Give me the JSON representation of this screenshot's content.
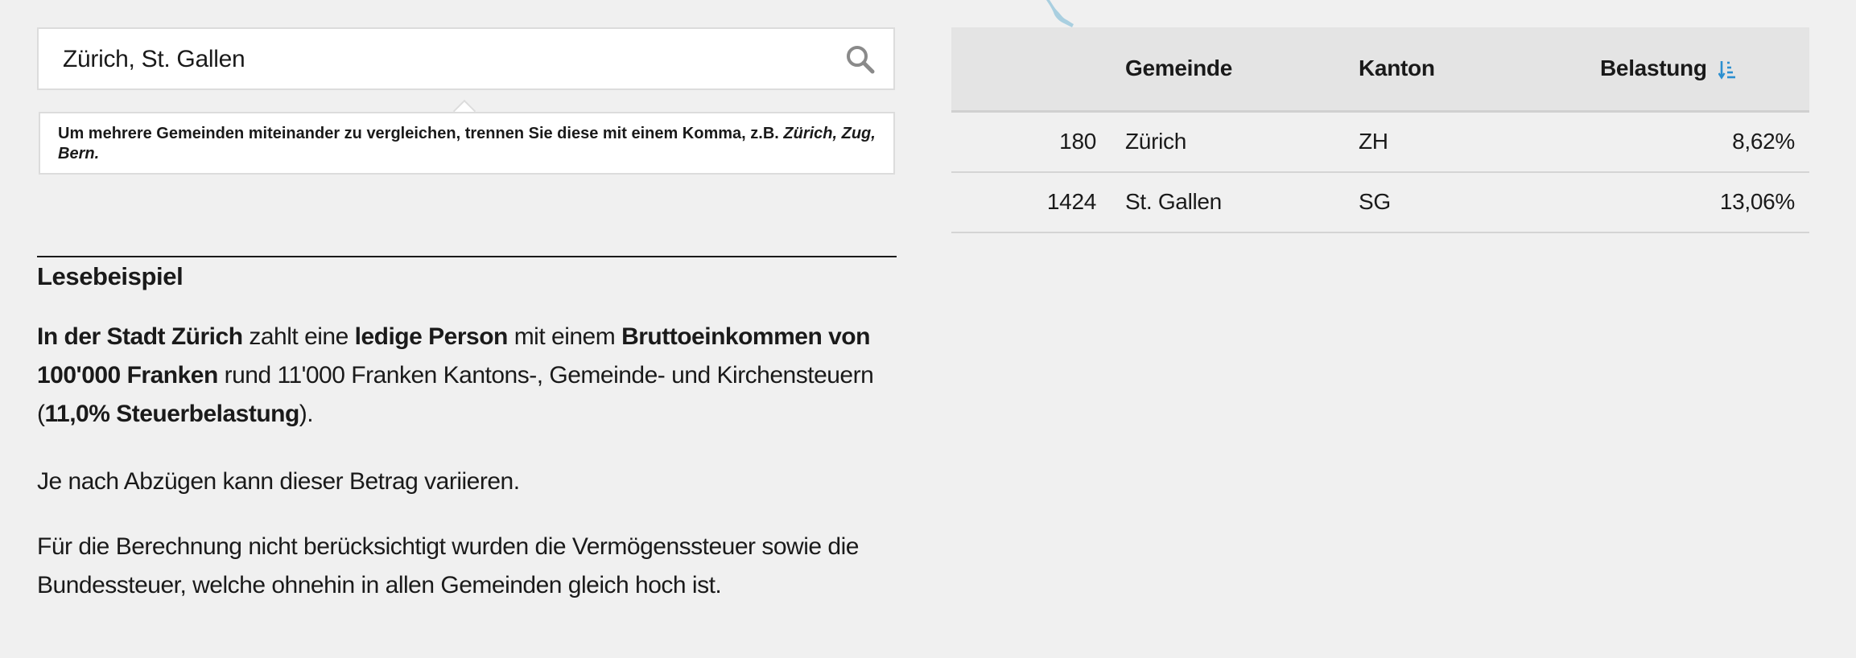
{
  "search": {
    "value": "Zürich, St. Gallen",
    "icon": "search-icon"
  },
  "hint": {
    "text": "Um mehrere Gemeinden miteinander zu vergleichen, trennen Sie diese mit einem Komma, z.B.",
    "examples": "Zürich, Zug, Bern."
  },
  "example": {
    "heading": "Lesebeispiel",
    "p1": {
      "b1": "In der Stadt Zürich",
      "t1": " zahlt eine ",
      "b2": "ledige Person",
      "t2": " mit einem ",
      "b3": "Bruttoeinkommen von 100'000 Franken",
      "t3": " rund 11'000 Franken Kantons-, Gemeinde- und Kirchensteuern (",
      "b4": "11,0% Steuerbelastung",
      "t4": ")."
    },
    "p2": "Je nach Abzügen kann dieser Betrag variieren.",
    "p3": "Für die Berechnung nicht berücksichtigt wurden die Vermögenssteuer sowie die Bundessteuer, welche ohnehin in allen Gemeinden gleich hoch ist."
  },
  "table": {
    "headers": {
      "rank": "",
      "gemeinde": "Gemeinde",
      "kanton": "Kanton",
      "belastung": "Belastung"
    },
    "sort_icon": "sort-descending-icon",
    "rows": [
      {
        "rank": "180",
        "gemeinde": "Zürich",
        "kanton": "ZH",
        "belastung": "8,62%"
      },
      {
        "rank": "1424",
        "gemeinde": "St. Gallen",
        "kanton": "SG",
        "belastung": "13,06%"
      }
    ]
  },
  "colors": {
    "background": "#f0f0f0",
    "accent": "#2b8fd0",
    "text": "#1a1a1a",
    "map_water": "#a9cfe0"
  }
}
